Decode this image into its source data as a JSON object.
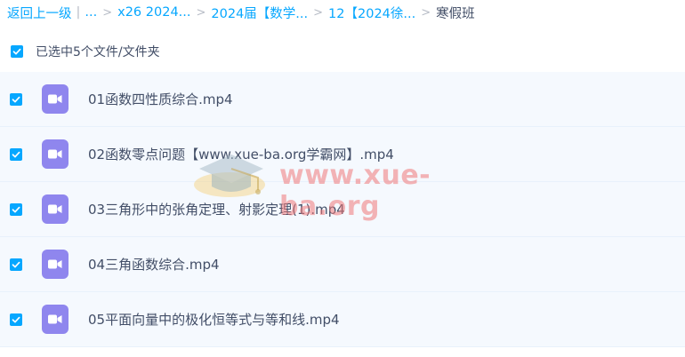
{
  "breadcrumb": {
    "back": "返回上一级",
    "ellipsis": "...",
    "items": [
      "x26 2024...",
      "2024届【数学...",
      "12【2024徐..."
    ],
    "current": "寒假班"
  },
  "selection": {
    "label": "已选中5个文件/文件夹"
  },
  "files": [
    {
      "name": "01函数四性质综合.mp4"
    },
    {
      "name": "02函数零点问题【www.xue-ba.org学霸网】.mp4"
    },
    {
      "name": "03三角形中的张角定理、射影定理(1).mp4"
    },
    {
      "name": "04三角函数综合.mp4"
    },
    {
      "name": "05平面向量中的极化恒等式与等和线.mp4"
    }
  ],
  "watermark": {
    "text": "www.xue-ba.org"
  },
  "colors": {
    "accent": "#06a7ff",
    "row_bg": "#f5f9fe",
    "video_icon": "#8f86ee"
  }
}
